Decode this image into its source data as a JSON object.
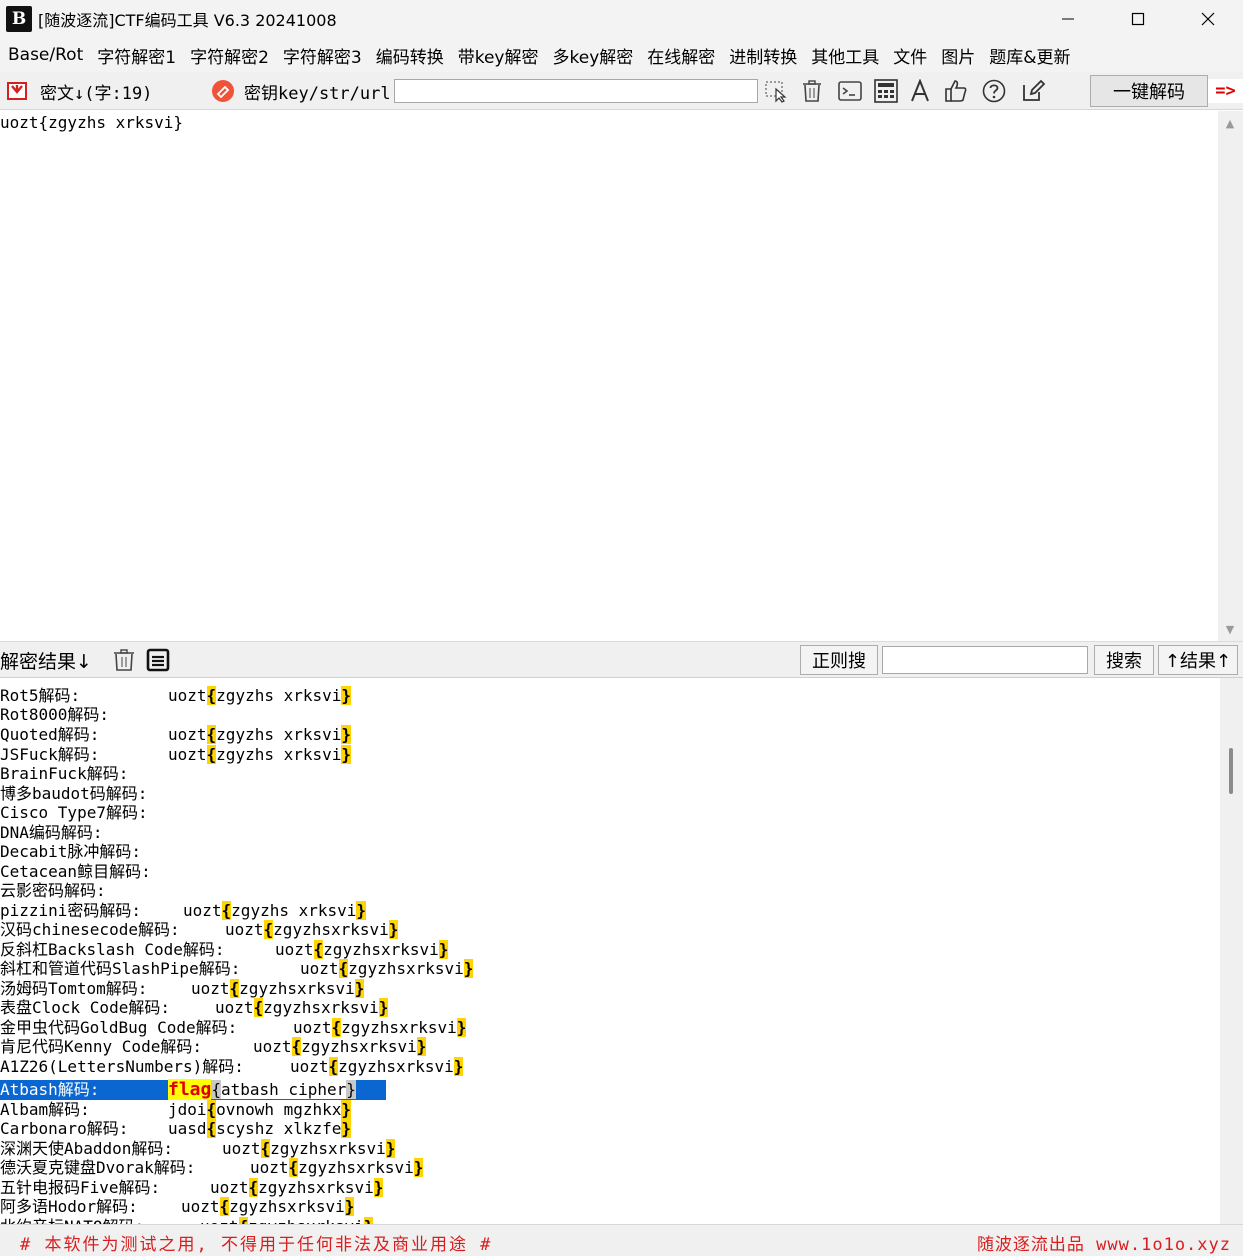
{
  "window": {
    "logo_text": "B",
    "title": "[随波逐流]CTF编码工具 V6.3 20241008"
  },
  "menu": [
    "Base/Rot",
    "字符解密1",
    "字符解密2",
    "字符解密3",
    "编码转换",
    "带key解密",
    "多key解密",
    "在线解密",
    "进制转换",
    "其他工具",
    "文件",
    "图片",
    "题库&更新"
  ],
  "toolbar": {
    "cipher_label": "密文↓(字:19)",
    "key_label": "密钥key/str/url:",
    "key_value": "",
    "decode_button": "一键解码",
    "arrow_text": "=>"
  },
  "input_text": "uozt{zgyzhs xrksvi}",
  "result_bar": {
    "label": "解密结果↓",
    "regex_button": "正则搜",
    "search_value": "",
    "search_button": "搜索",
    "up_button": "↑结果↑"
  },
  "results": [
    {
      "label": "Rot5解码:",
      "pre": "uozt",
      "mid": "zgyzhs xrksvi"
    },
    {
      "label": "Rot8000解码:",
      "pre": "",
      "mid": ""
    },
    {
      "label": "Quoted解码:",
      "pre": "uozt",
      "mid": "zgyzhs xrksvi"
    },
    {
      "label": "JSFuck解码:",
      "pre": "uozt",
      "mid": "zgyzhs xrksvi"
    },
    {
      "label": "BrainFuck解码:",
      "pre": "",
      "mid": ""
    },
    {
      "label": "博多baudot码解码:",
      "pre": "",
      "mid": ""
    },
    {
      "label": "Cisco Type7解码:",
      "pre": "",
      "mid": ""
    },
    {
      "label": "DNA编码解码:",
      "pre": "",
      "mid": ""
    },
    {
      "label": "Decabit脉冲解码:",
      "pre": "",
      "mid": ""
    },
    {
      "label": "Cetacean鲸目解码:",
      "pre": "",
      "mid": ""
    },
    {
      "label": "云影密码解码:",
      "pre": "",
      "mid": ""
    },
    {
      "label": "pizzini密码解码:",
      "pre": "uozt",
      "mid": "zgyzhs xrksvi"
    },
    {
      "label": "汉码chinesecode解码:",
      "pre": "uozt",
      "mid": "zgyzhsxrksvi"
    },
    {
      "label": "反斜杠Backslash Code解码:",
      "pre": "uozt",
      "mid": "zgyzhsxrksvi"
    },
    {
      "label": "斜杠和管道代码SlashPipe解码:",
      "pre": "uozt",
      "mid": "zgyzhsxrksvi"
    },
    {
      "label": "汤姆码Tomtom解码:",
      "pre": "uozt",
      "mid": "zgyzhsxrksvi"
    },
    {
      "label": "表盘Clock Code解码:",
      "pre": "uozt",
      "mid": "zgyzhsxrksvi"
    },
    {
      "label": "金甲虫代码GoldBug Code解码:",
      "pre": "uozt",
      "mid": "zgyzhsxrksvi"
    },
    {
      "label": "肯尼代码Kenny Code解码:",
      "pre": "uozt",
      "mid": "zgyzhsxrksvi"
    },
    {
      "label": "A1Z26(LettersNumbers)解码:",
      "pre": "uozt",
      "mid": "zgyzhsxrksvi"
    },
    {
      "label": "Atbash解码:",
      "pre": "flag",
      "mid": "atbash cipher"
    },
    {
      "label": "Albam解码:",
      "pre": "jdoi",
      "mid": "ovnowh mgzhkx"
    },
    {
      "label": "Carbonaro解码:",
      "pre": "uasd",
      "mid": "scyshz xlkzfe"
    },
    {
      "label": "深渊天使Abaddon解码:",
      "pre": "uozt",
      "mid": "zgyzhsxrksvi"
    },
    {
      "label": "德沃夏克键盘Dvorak解码:",
      "pre": "uozt",
      "mid": "zgyzhsxrksvi"
    },
    {
      "label": "五针电报码Five解码:",
      "pre": "uozt",
      "mid": "zgyzhsxrksvi"
    },
    {
      "label": "阿多语Hodor解码:",
      "pre": "uozt",
      "mid": "zgyzhsxrksvi"
    },
    {
      "label": "北约音标NATO解码:",
      "pre": "uozt",
      "mid": "zgyzhsxrksvi"
    }
  ],
  "brace_open": "{",
  "brace_close": "}",
  "status": {
    "left": "# 本软件为测试之用, 不得用于任何非法及商业用途 #",
    "right": "随波逐流出品 www.1o1o.xyz"
  },
  "colors": {
    "highlight": "#ffd400",
    "selection": "#0a66d0",
    "flag_text": "#e00000",
    "status_text": "#d81e1e"
  }
}
